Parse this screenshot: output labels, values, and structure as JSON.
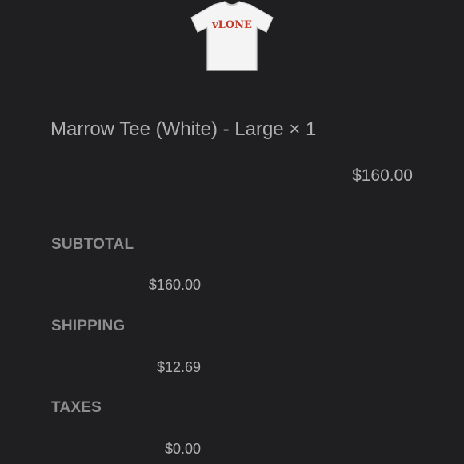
{
  "product": {
    "image_icon": "white-tshirt-image",
    "title": "Marrow Tee (White) - Large × 1",
    "price": "$160.00"
  },
  "summary": {
    "subtotal_label": "SUBTOTAL",
    "subtotal_value": "$160.00",
    "shipping_label": "SHIPPING",
    "shipping_value": "$12.69",
    "taxes_label": "TAXES",
    "taxes_value": "$0.00"
  },
  "colors": {
    "background": "#1f1f21",
    "text": "#b0b0b2",
    "label": "#8d8d90",
    "logo_red": "#c0392b"
  }
}
